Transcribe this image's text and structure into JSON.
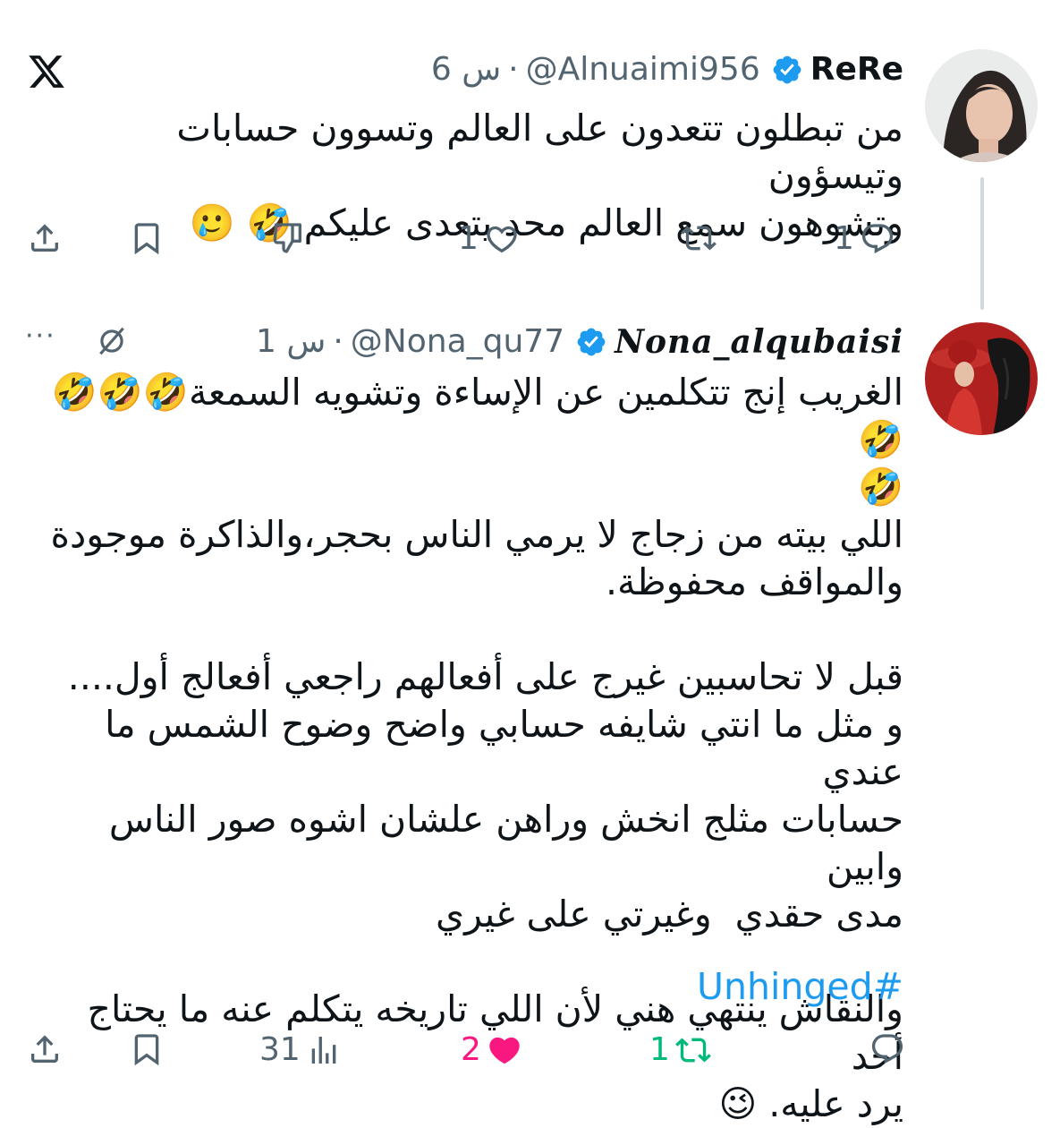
{
  "app": {
    "logo": "x-logo-icon"
  },
  "tweets": [
    {
      "name": "ReRe",
      "handle": "@Alnuaimi956",
      "separator": "·",
      "time": "6 س",
      "text": "من تبطلون تتعدون على العالم وتسوون حسابات وتيسؤون\nوتشوهون سمع العالم محد يتعدى عليكم 🤣 🥲",
      "actions": {
        "replies": "1",
        "retweets": "",
        "likes": "1",
        "views": ""
      }
    },
    {
      "name": "𝑵𝒐𝒏𝒂_𝒂𝒍𝒒𝒖𝒃𝒂𝒊𝒔𝒊",
      "handle": "@Nona_qu77",
      "separator": "·",
      "time": "1 س",
      "more": "···",
      "text": "الغريب إنج تتكلمين عن الإساءة وتشويه السمعة🤣🤣🤣🤣\n🤣\nاللي بيته من زجاج لا يرمي الناس بحجر،والذاكرة موجودة\nوالمواقف محفوظة.\n\nقبل لا تحاسبين غيرج على أفعالهم راجعي أفعالج أول....\nو مثل ما انتي شايفه حسابي واضح وضوح الشمس ما عندي\nحسابات مثلج انخش وراهن علشان اشوه صور الناس وابين\nمدى حقدي  وغيرتي على غيري\n\nوالنقاش ينتهي هني لأن اللي تاريخه يتكلم عنه ما يحتاج أحد\nيرد عليه. 😉",
      "hashtag": "#Unhinged",
      "actions": {
        "replies": "",
        "retweets": "1",
        "likes": "2",
        "views": "31"
      }
    }
  ],
  "colors": {
    "text": "#0f1419",
    "secondary": "#536471",
    "link": "#1d9bf0",
    "verified": "#1d9bf0",
    "retweet_active": "#00ba7c",
    "like_active": "#f91880"
  }
}
